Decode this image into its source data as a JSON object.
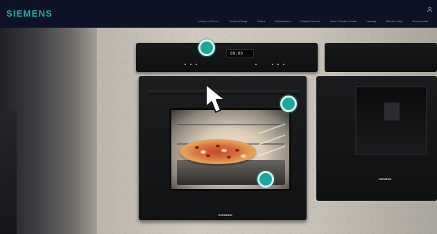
{
  "brand": {
    "logo_text": "SIEMENS",
    "accent_color": "#19b3a8"
  },
  "nav": {
    "items": [
      {
        "label": "Intelligent Kitchen",
        "active": true
      },
      {
        "label": "Product Range",
        "active": false
      },
      {
        "label": "Ovens",
        "active": false
      },
      {
        "label": "Dishwashers",
        "active": false
      },
      {
        "label": "Fridge-Freezers",
        "active": false
      },
      {
        "label": "Hobs / Cooker Hoods",
        "active": false
      },
      {
        "label": "Laundry",
        "active": false
      },
      {
        "label": "Where to buy",
        "active": false
      },
      {
        "label": "How it works",
        "active": false
      }
    ],
    "account_icon": "user-icon"
  },
  "oven": {
    "display_value": "00:00",
    "nameplate": "SIEMENS"
  },
  "right_appliance": {
    "nameplate": "SIEMENS"
  },
  "hotspots": [
    {
      "name": "hotspot-control-panel",
      "icon": "hotspot-dot-icon"
    },
    {
      "name": "hotspot-oven-interior",
      "icon": "hotspot-dot-icon"
    },
    {
      "name": "hotspot-oven-door",
      "icon": "hotspot-dot-icon"
    }
  ],
  "pointer": {
    "icon": "mouse-cursor-icon"
  }
}
